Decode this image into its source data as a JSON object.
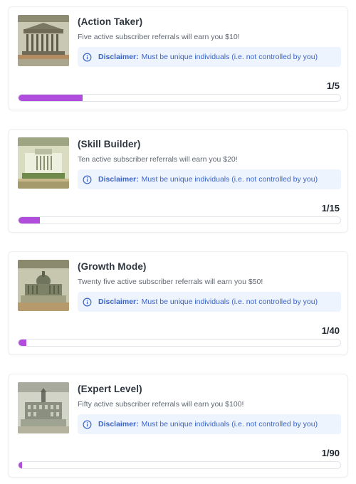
{
  "rewards": [
    {
      "title": "(Action Taker)",
      "description": "Five active subscriber referrals will earn you $10!",
      "notice_label": "Disclaimer:",
      "notice_text": "Must be unique individuals (i.e. not controlled by you)",
      "progress_text": "1/5",
      "progress_fraction": 0.2,
      "image": "ten-dollar-bill-treasury-icon"
    },
    {
      "title": "(Skill Builder)",
      "description": "Ten active subscriber referrals will earn you $20!",
      "notice_label": "Disclaimer:",
      "notice_text": "Must be unique individuals (i.e. not controlled by you)",
      "progress_text": "1/15",
      "progress_fraction": 0.0667,
      "image": "twenty-dollar-bill-white-house-icon"
    },
    {
      "title": "(Growth Mode)",
      "description": "Twenty five active subscriber referrals will earn you $50!",
      "notice_label": "Disclaimer:",
      "notice_text": "Must be unique individuals (i.e. not controlled by you)",
      "progress_text": "1/40",
      "progress_fraction": 0.025,
      "image": "fifty-dollar-bill-capitol-icon"
    },
    {
      "title": "(Expert Level)",
      "description": "Fifty active subscriber referrals will earn you $100!",
      "notice_label": "Disclaimer:",
      "notice_text": "Must be unique individuals (i.e. not controlled by you)",
      "progress_text": "1/90",
      "progress_fraction": 0.0111,
      "image": "hundred-dollar-bill-independence-hall-icon"
    }
  ],
  "colors": {
    "progress_fill": "#b14ddc",
    "notice_bg": "#eef4fd",
    "notice_text": "#3a63c8"
  }
}
